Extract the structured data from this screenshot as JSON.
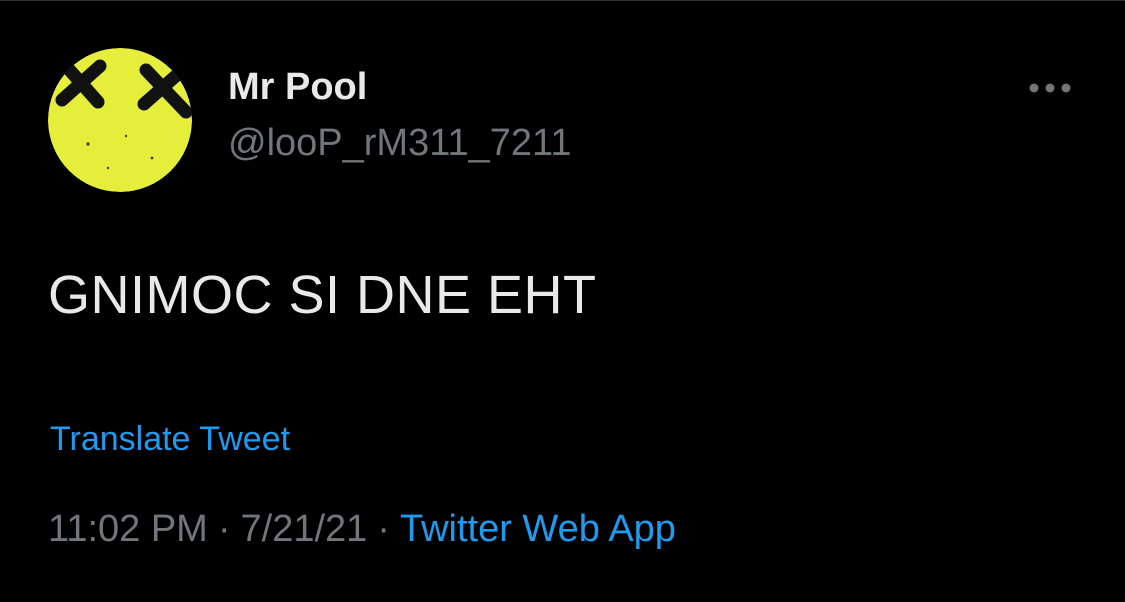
{
  "tweet": {
    "author": {
      "name": "Mr Pool",
      "handle": "@looP_rM311_7211",
      "avatar_icon": "yellow-smiley-x-eyes-icon"
    },
    "more_icon": "more-horizontal-icon",
    "text": "GNIMOC SI DNE EHT",
    "translate_label": "Translate Tweet",
    "time": "11:02 PM",
    "date": "7/21/21",
    "separator": "·",
    "source": "Twitter Web App"
  },
  "colors": {
    "background": "#000000",
    "text_primary": "#e7e9ea",
    "text_secondary": "#71767b",
    "accent": "#1d9bf0",
    "avatar_yellow": "#e6ee3c"
  }
}
